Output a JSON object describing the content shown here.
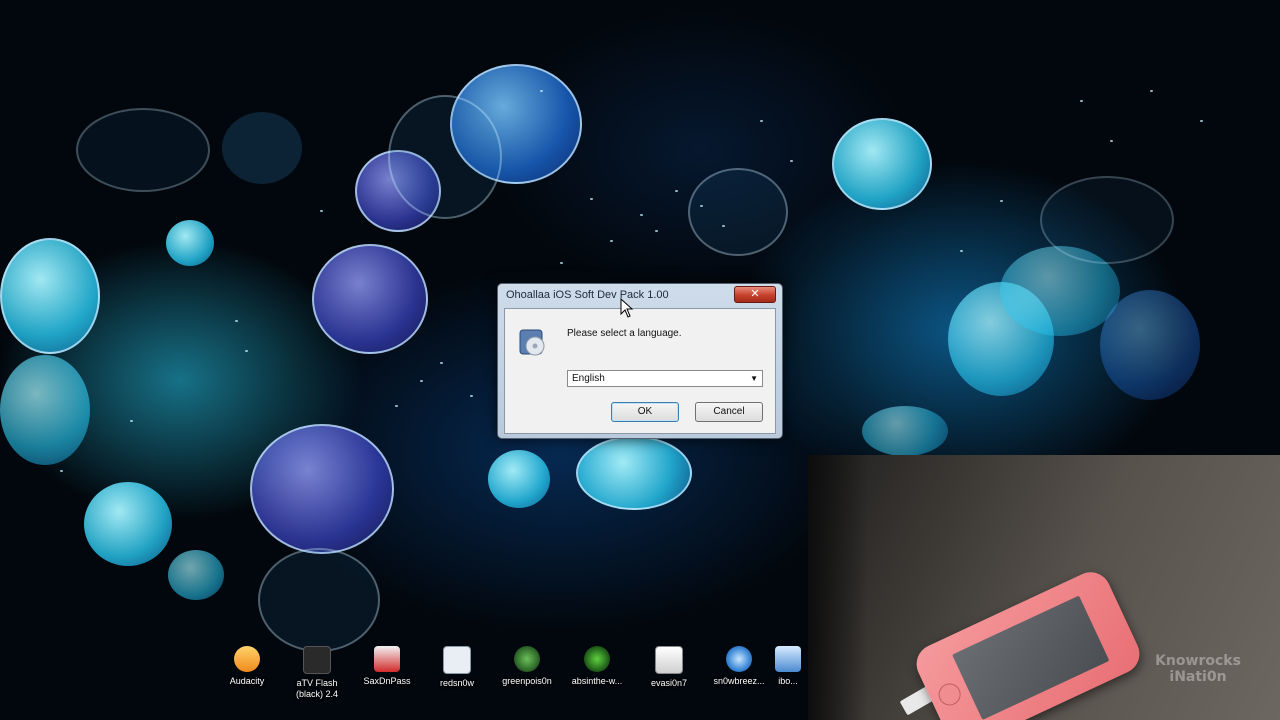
{
  "dialog": {
    "title": "Ohoallaа iOS Soft Dev Pack 1.00",
    "close_label": "✕",
    "prompt": "Please select a language.",
    "language_selected": "English",
    "ok_label": "OK",
    "cancel_label": "Cancel",
    "icon": "installer-disc-icon"
  },
  "desktop_icons": [
    {
      "label": "Audacity",
      "icon": "audacity-icon"
    },
    {
      "label": "aTV Flash\n(black) 2.4",
      "icon": "atv-flash-icon"
    },
    {
      "label": "SaxDnPass",
      "icon": "app-icon"
    },
    {
      "label": "redsn0w",
      "icon": "window-icon"
    },
    {
      "label": "greenpois0n",
      "icon": "greenpois0n-icon"
    },
    {
      "label": "absinthe-w...",
      "icon": "absinthe-icon"
    },
    {
      "label": "evasi0n7",
      "icon": "evasi0n-icon"
    },
    {
      "label": "sn0wbreez...",
      "icon": "snowbreeze-icon"
    },
    {
      "label": "ibo...",
      "icon": "app-icon"
    }
  ],
  "overlay": {
    "watermark": "Knowrocks\niNati0n"
  },
  "colors": {
    "desktop_bg": "#02070d",
    "accent_cyan": "#3ec8f0",
    "close_red": "#c6412c",
    "phone_pink": "#f08589"
  }
}
